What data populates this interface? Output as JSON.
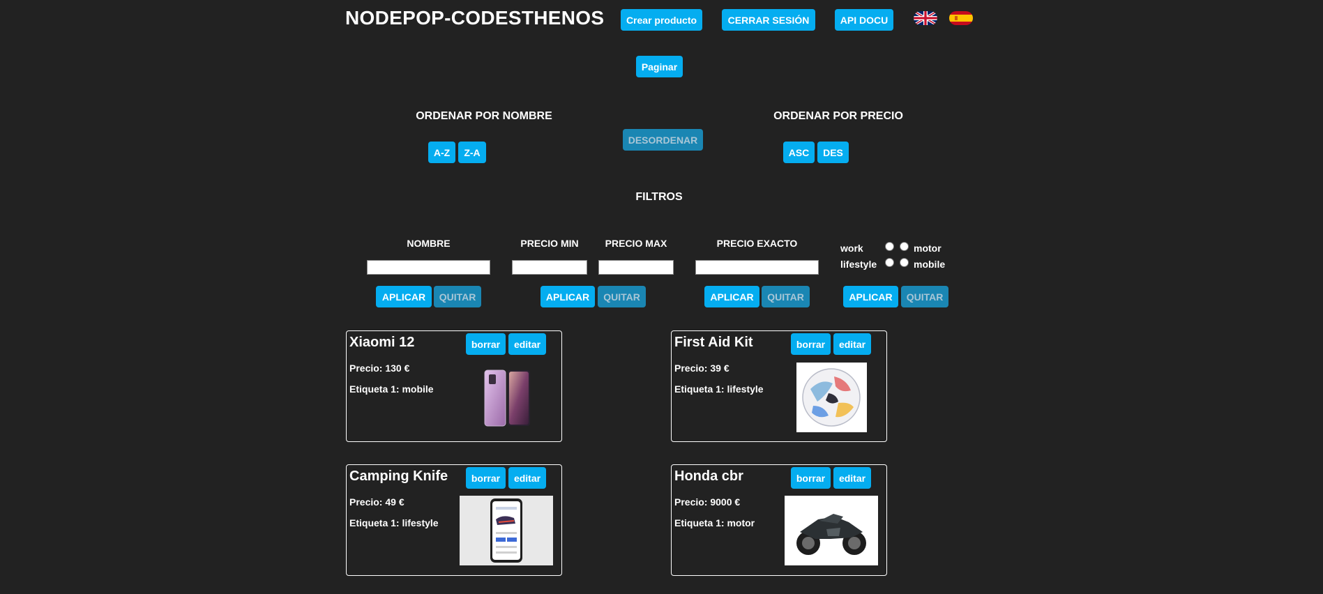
{
  "header": {
    "brand": "NODEPOP-CODESTHENOS",
    "create_label": "Crear producto",
    "logout_label": "CERRAR SESIÓN",
    "api_label": "API DOCU",
    "paginate_label": "Paginar"
  },
  "sort": {
    "by_name_heading": "ORDENAR POR NOMBRE",
    "az_label": "A-Z",
    "za_label": "Z-A",
    "unsort_label": "DESORDENAR",
    "by_price_heading": "ORDENAR POR PRECIO",
    "asc_label": "ASC",
    "des_label": "DES"
  },
  "filters": {
    "heading": "FILTROS",
    "name_label": "NOMBRE",
    "price_min_label": "PRECIO MIN",
    "price_max_label": "PRECIO MAX",
    "price_exact_label": "PRECIO EXACTO",
    "apply_label": "APLICAR",
    "remove_label": "QUITAR",
    "tags": {
      "work": "work",
      "motor": "motor",
      "lifestyle": "lifestyle",
      "mobile": "mobile"
    }
  },
  "cards": [
    {
      "name": "Xiaomi 12",
      "price": "Precio: 130 €",
      "tag": "Etiqueta 1: mobile",
      "delete_label": "borrar",
      "edit_label": "editar",
      "image": "phone-photo"
    },
    {
      "name": "First Aid Kit",
      "price": "Precio: 39 €",
      "tag": "Etiqueta 1: lifestyle",
      "delete_label": "borrar",
      "edit_label": "editar",
      "image": "soccer-ball-photo"
    },
    {
      "name": "Camping Knife",
      "price": "Precio: 49 €",
      "tag": "Etiqueta 1: lifestyle",
      "delete_label": "borrar",
      "edit_label": "editar",
      "image": "app-screenshot-photo"
    },
    {
      "name": "Honda cbr",
      "price": "Precio: 9000 €",
      "tag": "Etiqueta 1: motor",
      "delete_label": "borrar",
      "edit_label": "editar",
      "image": "motorcycle-photo"
    }
  ],
  "colors": {
    "background": "#222222",
    "accent": "#05adf0",
    "accent_dim": "#1a86b3"
  },
  "icons": [
    "uk-flag-icon",
    "spain-flag-icon"
  ]
}
